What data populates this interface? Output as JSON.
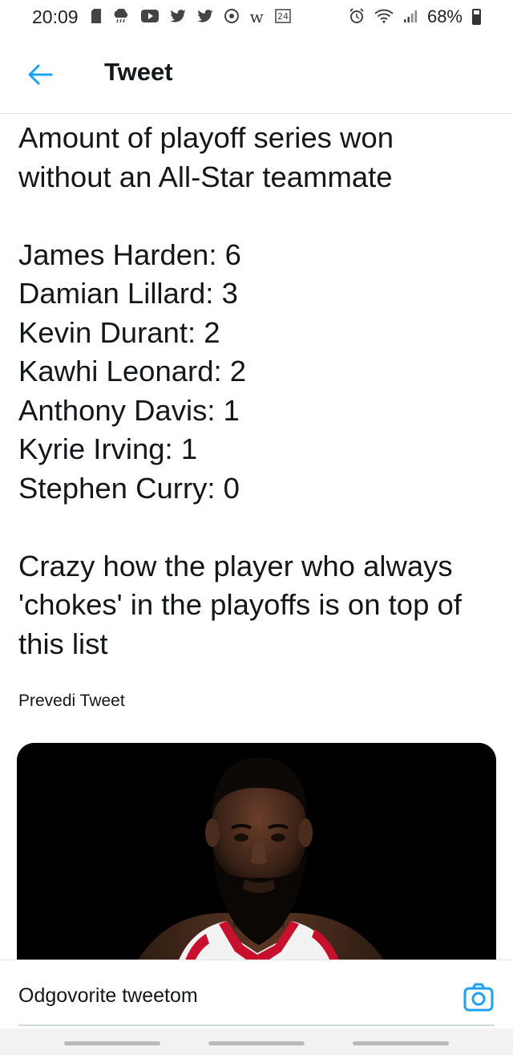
{
  "status_bar": {
    "time": "20:09",
    "battery": "68%",
    "icons_left": [
      "sd-card-icon",
      "weather-icon",
      "youtube-icon",
      "twitter-icon",
      "twitter-icon",
      "browser-icon",
      "w-app-icon",
      "news-24-icon"
    ],
    "icons_right": [
      "alarm-icon",
      "wifi-icon",
      "signal-icon",
      "battery-icon"
    ]
  },
  "header": {
    "title": "Tweet",
    "back_icon": "arrow-left-icon",
    "accent_color": "#1da1f2"
  },
  "tweet": {
    "lines": [
      "Amount of playoff series won",
      "without an All-Star teammate",
      "",
      "James Harden: 6",
      "Damian Lillard: 3",
      "Kevin Durant: 2",
      "Kawhi Leonard: 2",
      "Anthony Davis: 1",
      "Kyrie Irving: 1",
      "Stephen Curry: 0",
      "",
      "Crazy how the player who always",
      "'chokes' in the playoffs is on top of",
      "this list"
    ],
    "translate_label": "Prevedi Tweet"
  },
  "media": {
    "type": "photo",
    "subject": "player-photo"
  },
  "reply_bar": {
    "placeholder": "Odgovorite tweetom",
    "camera_icon": "camera-icon"
  }
}
